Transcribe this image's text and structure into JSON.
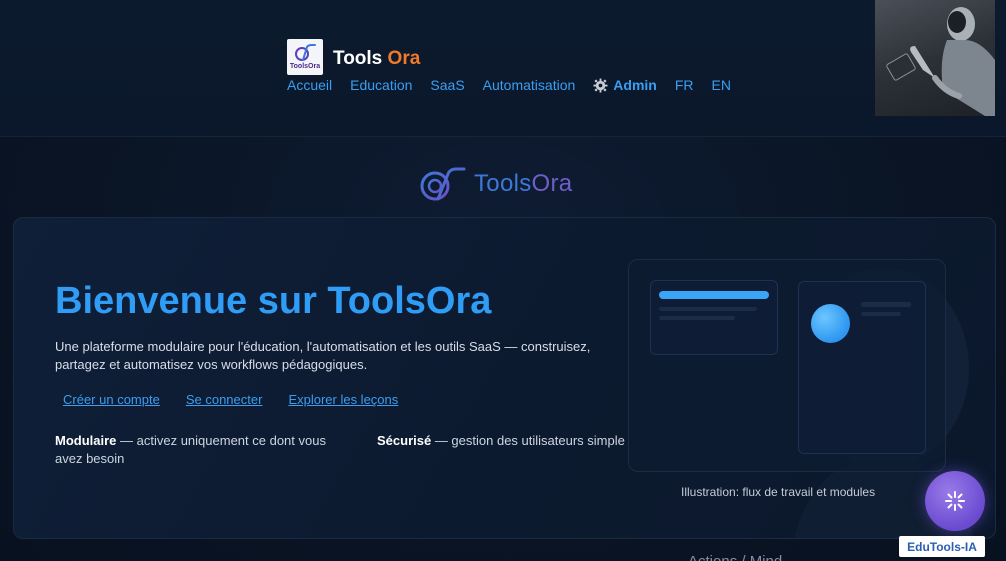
{
  "header": {
    "logo_caption": "ToolsOra",
    "brand_primary": "Tools",
    "brand_accent": "Ora",
    "nav": {
      "home": "Accueil",
      "education": "Education",
      "saas": "SaaS",
      "automation": "Automatisation",
      "admin": "Admin",
      "lang_fr": "FR",
      "lang_en": "EN"
    }
  },
  "center_logo": {
    "part1": "Tools",
    "part2": "Ora"
  },
  "hero": {
    "title": "Bienvenue sur ToolsOra",
    "description": "Une plateforme modulaire pour l'éducation, l'automatisation et les outils SaaS — construisez, partagez et automatisez vos workflows pédagogiques.",
    "links": {
      "signup": "Créer un compte",
      "login": "Se connecter",
      "lessons": "Explorer les leçons"
    },
    "features": [
      {
        "title": "Modulaire",
        "text": " — activez uniquement ce dont vous avez besoin"
      },
      {
        "title": "Sécurisé",
        "text": " — gestion des utilisateurs simple"
      }
    ],
    "illustration_caption": "Illustration: flux de travail et modules"
  },
  "assistant": {
    "label": "EduTools-IA",
    "icon": "sparkle-icon"
  },
  "next_section_peek": "Actions / Mind...",
  "colors": {
    "accent_blue": "#2f9cf5",
    "brand_orange": "#f07a28",
    "assistant_purple": "#6a4bd0",
    "background": "#0a1424"
  }
}
